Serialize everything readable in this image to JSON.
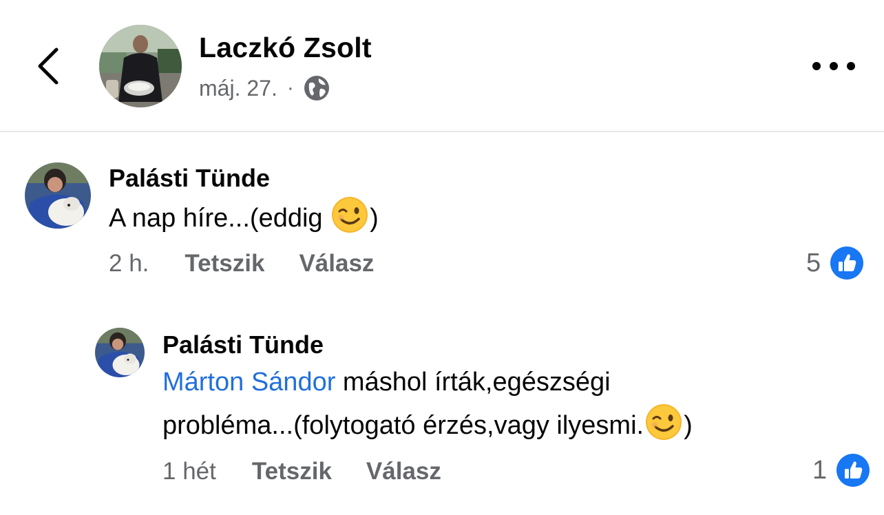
{
  "header": {
    "author": "Laczkó Zsolt",
    "date": "máj. 27.",
    "separator": "·",
    "privacy_icon": "globe-icon",
    "back_icon": "chevron-left-icon",
    "more_icon": "more-horizontal-icon"
  },
  "comments": [
    {
      "name": "Palásti Tünde",
      "text": "A nap híre...(eddig ",
      "text_end": ")",
      "emoji": "winking-face",
      "time": "2 h.",
      "like_label": "Tetszik",
      "reply_label": "Válasz",
      "like_count": "5"
    }
  ],
  "reply": {
    "name": "Palásti Tünde",
    "mention": "Márton Sándor",
    "text_line1": " máshol írták,egészségi",
    "text_line2": "probléma...(folytogató érzés,vagy ilyesmi.",
    "text_end": ")",
    "emoji": "winking-face",
    "time": "1 hét",
    "like_label": "Tetszik",
    "reply_label": "Válasz",
    "like_count": "1"
  },
  "colors": {
    "accent_blue": "#1877f2",
    "mention_blue": "#216fdb",
    "secondary_text": "#65676b",
    "divider": "#e4e6eb"
  }
}
